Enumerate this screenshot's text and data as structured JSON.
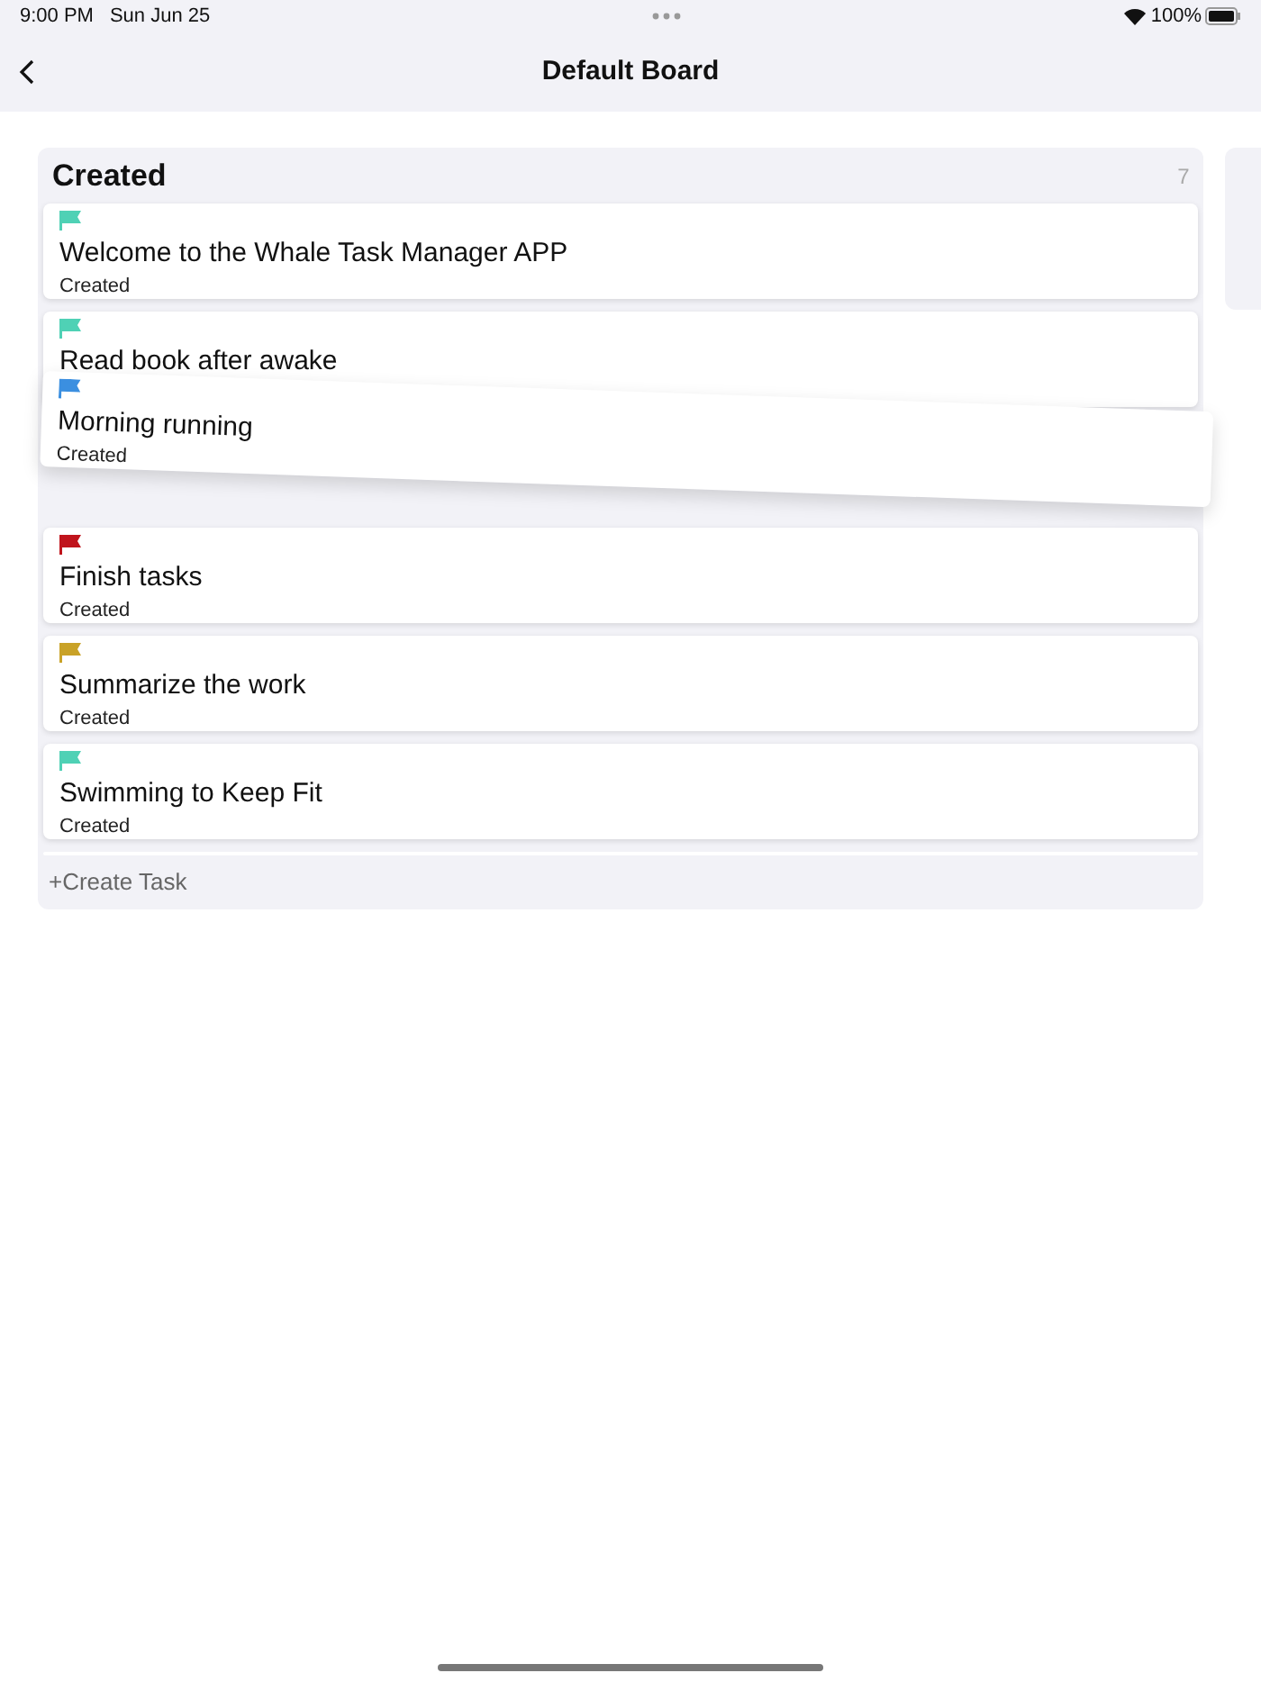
{
  "status_bar": {
    "time": "9:00 PM",
    "date": "Sun Jun 25",
    "battery": "100%"
  },
  "nav": {
    "title": "Default Board"
  },
  "column": {
    "title": "Created",
    "count": "7",
    "cards": [
      {
        "title": "Welcome to the Whale Task Manager APP",
        "status": "Created",
        "color": "#4fd1b5",
        "dragging": false
      },
      {
        "title": "Read book after awake",
        "color": "#4fd1b5",
        "dragging": false
      },
      {
        "title": "Morning running",
        "status": "Created",
        "color": "#3b8fe0",
        "dragging": true
      },
      {
        "title": "Finish tasks",
        "status": "Created",
        "color": "#c0141c",
        "dragging": false
      },
      {
        "title": "Summarize the work",
        "status": "Created",
        "color": "#c9a227",
        "dragging": false
      },
      {
        "title": "Swimming to Keep Fit",
        "status": "Created",
        "color": "#4fd1b5",
        "dragging": false
      }
    ],
    "create_label": "+Create Task"
  }
}
